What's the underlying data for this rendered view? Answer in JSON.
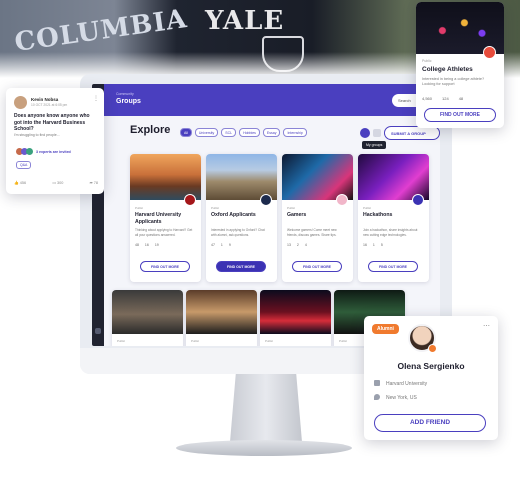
{
  "background": {
    "shirt_left_text": "COLUMBIA",
    "shirt_center_text": "YALE"
  },
  "app": {
    "crumb": "Community",
    "title": "Groups",
    "search_placeholder": "Search",
    "explore_title": "Explore",
    "filters": [
      "All",
      "University",
      "SCL",
      "Hobbies",
      "Essay",
      "Internship"
    ],
    "my_groups_tooltip": "My groups",
    "submit_label": "SUBMIT A GROUP",
    "cards": [
      {
        "visibility": "Public",
        "name": "Harvard University Applicants",
        "desc": "Thinking about applying to Harvard? Get all your questions answered.",
        "stats": [
          "48",
          "16",
          "19"
        ],
        "button": "FIND OUT MORE"
      },
      {
        "visibility": "Public",
        "name": "Oxford Applicants",
        "desc": "Interested in applying to Oxford? Chat with alumni, ask questions.",
        "stats": [
          "47",
          "1",
          "9"
        ],
        "button": "FIND OUT MORE"
      },
      {
        "visibility": "Public",
        "name": "Gamers",
        "desc": "Welcome gamers! Come meet new friends, discuss games. Share tips.",
        "stats": [
          "13",
          "2",
          "4"
        ],
        "button": "FIND OUT MORE"
      },
      {
        "visibility": "Public",
        "name": "Hackathons",
        "desc": "Join a hackathon, share insights about new cutting edge technologies.",
        "stats": [
          "16",
          "1",
          "5"
        ],
        "button": "FIND OUT MORE"
      }
    ],
    "row2": [
      "Public",
      "Public",
      "Public",
      "Public"
    ]
  },
  "question_card": {
    "user": "Kevin Nobsa",
    "time": "10 OCT 2021 at 6:05 pm",
    "question": "Does anyone know anyone who got into the Harvard Business School?",
    "body": "I'm struggling to find people...",
    "experts": "3 experts are invited",
    "tag": "Q&A",
    "likes": "456",
    "comments": "300",
    "shares": "78"
  },
  "athletes_card": {
    "visibility": "Public",
    "name": "College Athletes",
    "desc": "Interested in being a college athlete? Looking for support",
    "stats": [
      "4,560",
      "124",
      "48"
    ],
    "button": "FIND OUT MORE"
  },
  "profile_card": {
    "badge": "Alumni",
    "name": "Olena Sergienko",
    "school": "Harvard University",
    "location": "New York, US",
    "button": "ADD FRIEND"
  },
  "colors": {
    "accent": "#4a3fbf",
    "alumni": "#f07a2e"
  }
}
